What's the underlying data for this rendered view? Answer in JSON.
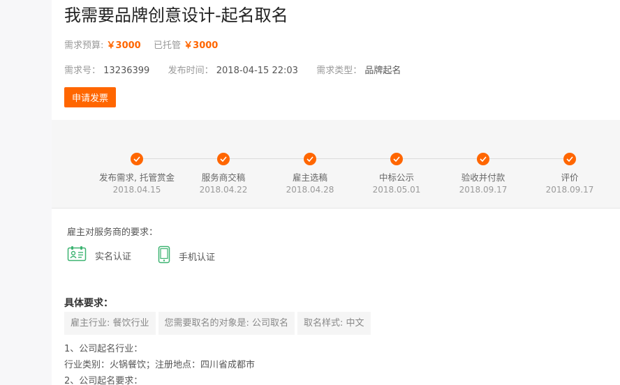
{
  "title": "我需要品牌创意设计-起名取名",
  "budget": {
    "label": "需求预算:",
    "amount": "￥3000",
    "escrow_label": "已托管",
    "escrow_amount": "￥3000"
  },
  "meta": {
    "id_label": "需求号：",
    "id": "13236399",
    "time_label": "发布时间：",
    "time": "2018-04-15 22:03",
    "type_label": "需求类型：",
    "type": "品牌起名"
  },
  "invoice_button": "申请发票",
  "steps": [
    {
      "label": "发布需求, 托管赏金",
      "date": "2018.04.15"
    },
    {
      "label": "服务商交稿",
      "date": "2018.04.22"
    },
    {
      "label": "雇主选稿",
      "date": "2018.04.28"
    },
    {
      "label": "中标公示",
      "date": "2018.05.01"
    },
    {
      "label": "验收并付款",
      "date": "2018.09.17"
    },
    {
      "label": "评价",
      "date": "2018.09.17"
    }
  ],
  "requirements": {
    "title": "雇主对服务商的要求：",
    "items": [
      {
        "label": "实名认证",
        "icon": "id-card-icon"
      },
      {
        "label": "手机认证",
        "icon": "mobile-phone-icon"
      }
    ]
  },
  "details": {
    "title": "具体要求：",
    "tags": [
      "雇主行业: 餐饮行业",
      "您需要取名的对象是: 公司取名",
      "取名样式: 中文"
    ],
    "lines": [
      "1、公司起名行业：",
      "行业类别：火锅餐饮；注册地点：四川省成都市",
      "2、公司起名要求："
    ]
  },
  "colors": {
    "accent": "#ff6600",
    "cert_green": "#3cb371"
  }
}
